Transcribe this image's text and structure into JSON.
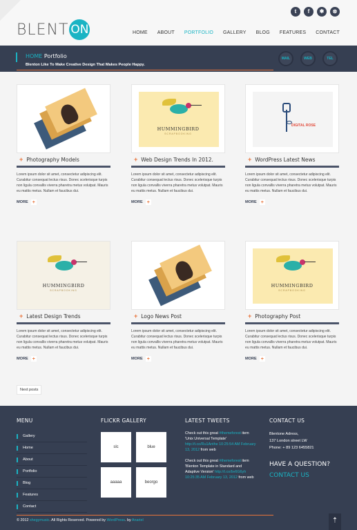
{
  "header": {
    "logo_text": "BLENT",
    "logo_circle": "ON",
    "socials": [
      {
        "icon": "twitter-icon",
        "glyph": "t"
      },
      {
        "icon": "facebook-icon",
        "glyph": "f"
      },
      {
        "icon": "flickr-icon",
        "glyph": "✱"
      },
      {
        "icon": "dribbble-icon",
        "glyph": "⊗"
      }
    ],
    "nav": [
      "HOME",
      "ABOUT",
      "PORTFOLIO",
      "GALLERY",
      "BLOG",
      "FEATURES",
      "CONTACT"
    ],
    "nav_active": "PORTFOLIO"
  },
  "titlebar": {
    "home": "HOME",
    "current": "Portfolio",
    "tagline": "Blenton Like To Make Creative Design That Makes People Happy.",
    "buttons": [
      "MAIL",
      "WEB",
      "TEL"
    ]
  },
  "posts": [
    {
      "title": "Photography Models",
      "text": "Lorem ipsum dolor sit amet, consectetur adipiscing elit. Curabitur consequat lectus risus. Donec scelerisque turpis non ligula convallis viverra pharetra metus volutpat. Mauris eu mattis metus. Nullam et faucibus dui.",
      "more": "MORE",
      "thumb": "business-cards",
      "bird_label": "",
      "bird_sub": "",
      "rose_label": ""
    },
    {
      "title": "Web Design Trends In 2012.",
      "text": "Lorem ipsum dolor sit amet, consectetur adipiscing elit. Curabitur consequat lectus risus. Donec scelerisque turpis non ligula convallis viverra pharetra metus volutpat. Mauris eu mattis metus. Nullam et faucibus dui.",
      "more": "MORE",
      "thumb": "hummingbird",
      "bird_label": "HUMMINGBIRD",
      "bird_sub": "SCRAPBOOKING",
      "rose_label": ""
    },
    {
      "title": "WordPress Latest News",
      "text": "Lorem ipsum dolor sit amet, consectetur adipiscing elit. Curabitur consequat lectus risus. Donec scelerisque turpis non ligula convallis viverra pharetra metus volutpat. Mauris eu mattis metus. Nullam et faucibus dui.",
      "more": "MORE",
      "thumb": "digital-rose",
      "bird_label": "",
      "bird_sub": "",
      "rose_label": "DIGITAL ROSE"
    },
    {
      "title": "Latest Design Trends",
      "text": "Lorem ipsum dolor sit amet, consectetur adipiscing elit. Curabitur consequat lectus risus. Donec scelerisque turpis non ligula convallis viverra pharetra metus volutpat. Mauris eu mattis metus. Nullam et faucibus dui.",
      "more": "MORE",
      "thumb": "hummingbird-large",
      "bird_label": "HUMMINGBIRD",
      "bird_sub": "SCRAPBOOKING",
      "rose_label": ""
    },
    {
      "title": "Logo News Post",
      "text": "Lorem ipsum dolor sit amet, consectetur adipiscing elit. Curabitur consequat lectus risus. Donec scelerisque turpis non ligula convallis viverra pharetra metus volutpat. Mauris eu mattis metus. Nullam et faucibus dui.",
      "more": "MORE",
      "thumb": "business-cards",
      "bird_label": "",
      "bird_sub": "",
      "rose_label": ""
    },
    {
      "title": "Photography Post",
      "text": "Lorem ipsum dolor sit amet, consectetur adipiscing elit. Curabitur consequat lectus risus. Donec scelerisque turpis non ligula convallis viverra pharetra metus volutpat. Mauris eu mattis metus. Nullam et faucibus dui.",
      "more": "MORE",
      "thumb": "hummingbird",
      "bird_label": "HUMMINGBIRD",
      "bird_sub": "SCRAPBOOKING",
      "rose_label": ""
    }
  ],
  "next_posts": "Next posts",
  "footer": {
    "menu_title": "MENU",
    "menu": [
      "Gallery",
      "Home",
      "About",
      "Portfolio",
      "Blog",
      "Features",
      "Contact"
    ],
    "flickr_title": "FLICKR GALLERY",
    "flickr": [
      "slc",
      "blue",
      "aaaaa",
      "beorgo"
    ],
    "tweets_title": "LATEST TWEETS",
    "tweets": [
      {
        "pre": "Check out this great ",
        "tag": "#themeforest",
        "mid": " item 'Unix Universal Template' ",
        "link": "http://t.co/Ru1Anthe 10:25:54 AM February 13, 2012",
        "post": " from web"
      },
      {
        "pre": "Check out this great ",
        "tag": "#themeforest",
        "mid": " item 'Blenton Template in Standard and Adaptive Version' ",
        "link": "http://t.co/bv6G6yh 10:25:35 AM February 13, 2012",
        "post": " from web"
      }
    ],
    "contact_title": "CONTACT US",
    "contact": [
      "Blentone Adress,",
      "137 London street LW",
      "Phone: + 89 123 6455821"
    ],
    "question": "HAVE A QUESTION?",
    "contact_us": "CONTACT US",
    "copyright_pre": "© 2012 ",
    "copyright_site": "shegymusic",
    "copyright_mid": ". All Rights Reserved. Powered by ",
    "copyright_wp": "WordPress",
    "copyright_by": ". by ",
    "copyright_author": "Anariel",
    "to_top": "⇡"
  },
  "colors": {
    "accent": "#1ab4c4",
    "orange": "#e8743b",
    "dark": "#363f52"
  }
}
